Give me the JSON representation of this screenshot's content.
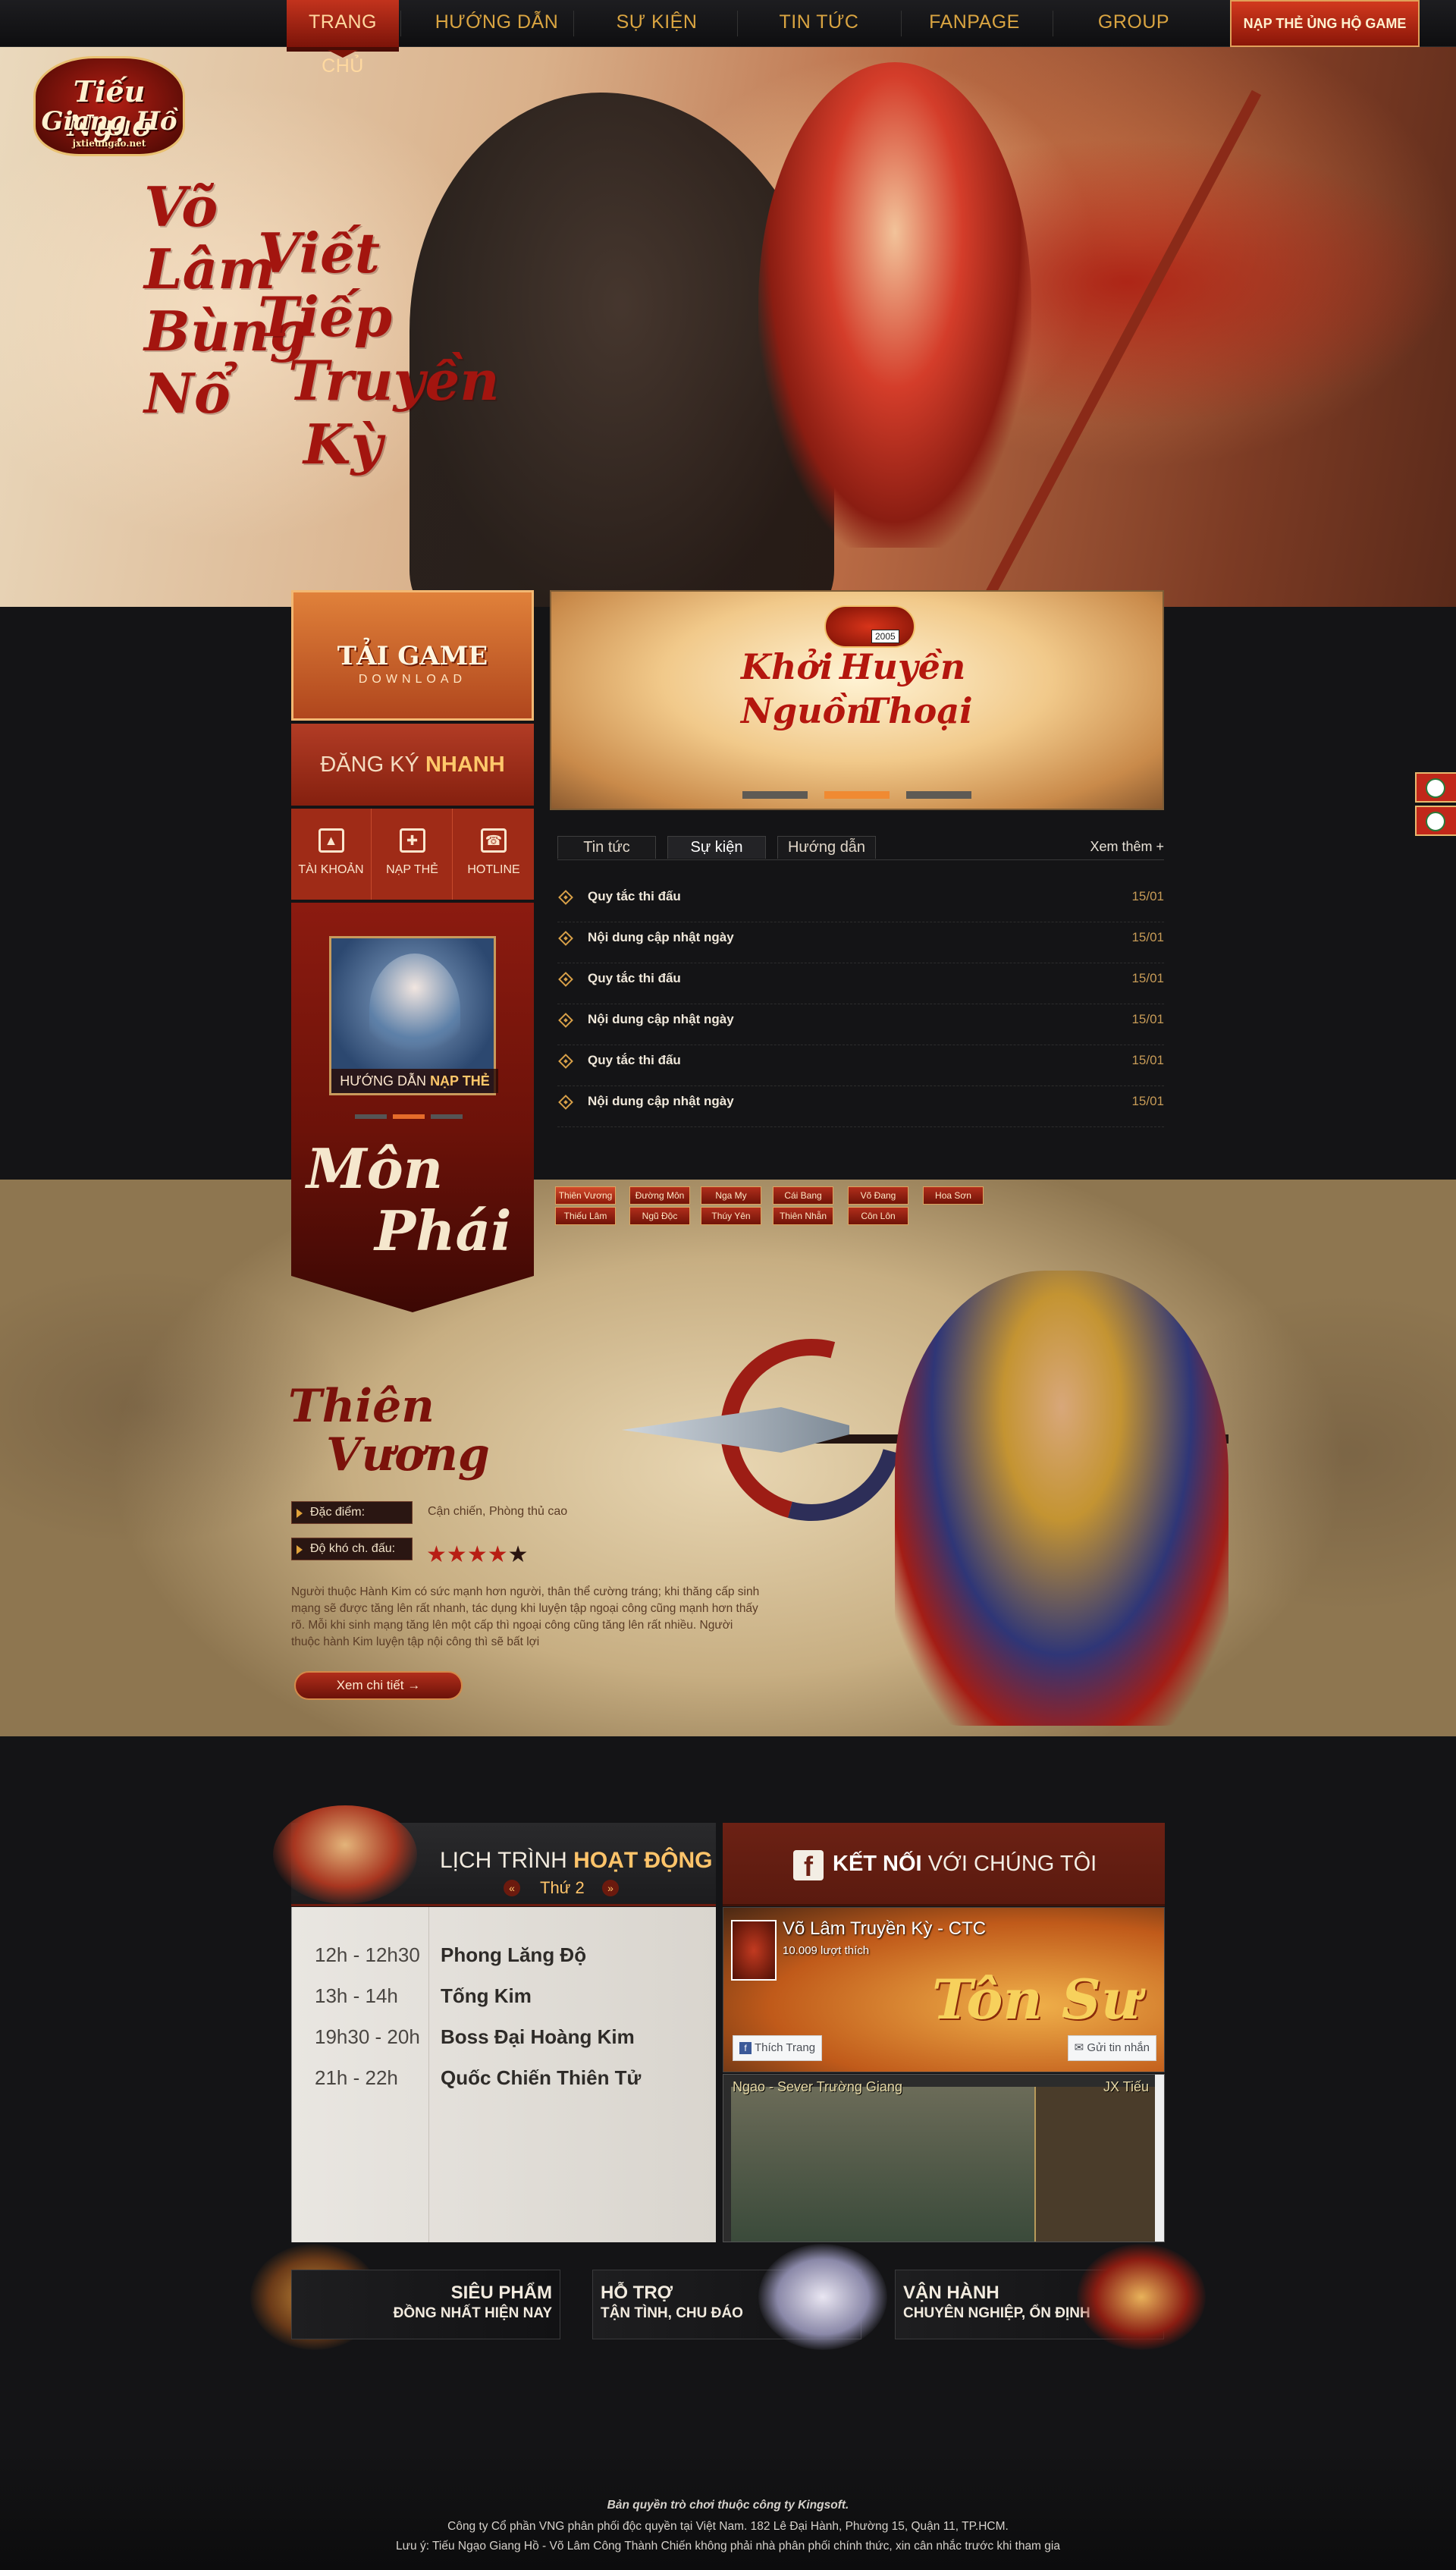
{
  "nav": {
    "items": [
      "TRANG CHỦ",
      "HƯỚNG DẪN",
      "SỰ KIỆN",
      "TIN TỨC",
      "FANPAGE",
      "GROUP"
    ],
    "topup_button": "NẠP THẺ ỦNG HỘ GAME"
  },
  "hero": {
    "logo_line1": "Tiếu Ngạo",
    "logo_line2": "Giang Hồ",
    "logo_site": "jxtieungao.net",
    "slogan_col1": [
      "Võ",
      "Lâm",
      "Bùng",
      "Nổ"
    ],
    "slogan_col2": [
      "Viết",
      "Tiếp",
      "Truyền",
      "Kỳ"
    ]
  },
  "left_panel": {
    "download_title": "TẢI GAME",
    "download_sub": "DOWNLOAD",
    "register_prefix": "ĐĂNG KÝ",
    "register_bold": "NHANH",
    "quick_links": [
      {
        "label": "TÀI KHOẢN",
        "icon": "account-icon"
      },
      {
        "label": "NẠP THẺ",
        "icon": "gift-icon"
      },
      {
        "label": "HOTLINE",
        "icon": "phone-icon"
      }
    ],
    "promo_prefix": "HƯỚNG DẪN",
    "promo_bold": "NẠP THẺ",
    "promo_active_dot": 1
  },
  "banner": {
    "badge_year": "2005",
    "words": [
      "Khởi",
      "Huyền",
      "Nguồn",
      "Thoại"
    ],
    "active_dot": 1
  },
  "news": {
    "tabs": [
      "Tin tức",
      "Sự kiện",
      "Hướng dẫn"
    ],
    "active_tab": 1,
    "more": "Xem thêm +",
    "items": [
      {
        "title": "Quy tắc thi đấu",
        "date": "15/01"
      },
      {
        "title": "Nội dung cập nhật ngày",
        "date": "15/01"
      },
      {
        "title": "Quy tắc thi đấu",
        "date": "15/01"
      },
      {
        "title": "Nội dung cập nhật ngày",
        "date": "15/01"
      },
      {
        "title": "Quy tắc thi đấu",
        "date": "15/01"
      },
      {
        "title": "Nội dung cập nhật ngày",
        "date": "15/01"
      }
    ]
  },
  "faction": {
    "section_title": [
      "Môn",
      "Phái"
    ],
    "buttons_row1": [
      "Thiên Vương",
      "Đường Môn",
      "Nga My",
      "Cái Bang",
      "Võ Đang",
      "Hoa Sơn"
    ],
    "buttons_row2": [
      "Thiếu Lâm",
      "Ngũ Độc",
      "Thúy Yên",
      "Thiên Nhẫn",
      "Côn Lôn"
    ],
    "selected": "Thiên Vương",
    "class_name": [
      "Thiên",
      "Vương"
    ],
    "attr1_label": "Đặc điểm:",
    "attr1_value": "Cận chiến, Phòng thủ cao",
    "attr2_label": "Độ khó ch. đấu:",
    "difficulty_stars": 4,
    "difficulty_max": 5,
    "description": "Người thuộc Hành Kim có sức mạnh hơn người, thân thể cường tráng; khi thăng cấp sinh mạng sẽ được tăng lên rất nhanh, tác dụng khi luyện tập ngoại công cũng mạnh hơn thấy rõ. Mỗi khi sinh mạng tăng lên một cấp thì ngoại công cũng tăng lên rất nhiều. Người thuộc hành Kim luyện tập nội công thì sẽ bất lợi",
    "detail_button": "Xem chi tiết"
  },
  "schedule": {
    "title_prefix": "LỊCH TRÌNH",
    "title_bold": "HOẠT ĐỘNG",
    "day": "Thứ 2",
    "rows": [
      {
        "time": "12h - 12h30",
        "event": "Phong Lăng Độ"
      },
      {
        "time": "13h - 14h",
        "event": "Tống Kim"
      },
      {
        "time": "19h30 - 20h",
        "event": "Boss Đại Hoàng Kim"
      },
      {
        "time": "21h - 22h",
        "event": "Quốc Chiến Thiên Tử"
      }
    ]
  },
  "connect": {
    "title_bold": "KẾT NỐI",
    "title_rest": "VỚI CHÚNG TÔI",
    "page_name": "Võ Lâm Truyền Kỳ - CTC",
    "likes": "10.009 lượt thích",
    "cover_text": "Tôn Sư",
    "like_button": "Thích Trang",
    "message_button": "Gửi tin nhắn",
    "video_title": "Ngao - Sever Trường Giang",
    "video_title_right": "JX Tiếu"
  },
  "features": [
    {
      "title": "SIÊU PHẨM",
      "sub": "ĐỒNG NHẤT HIỆN NAY"
    },
    {
      "title": "HỖ TRỢ",
      "sub": "TẬN TÌNH, CHU ĐÁO"
    },
    {
      "title": "VẬN HÀNH",
      "sub": "CHUYÊN NGHIỆP, ỔN ĐỊNH"
    }
  ],
  "footer": {
    "line1": "Bản quyền trò chơi thuộc công ty Kingsoft.",
    "line2": "Công ty Cổ phần VNG phân phối độc quyền tại Việt Nam. 182 Lê Đại Hành, Phường 15, Quận 11, TP.HCM.",
    "line3": "Lưu ý: Tiếu Ngạo Giang Hồ - Võ Lâm Công Thành Chiến không phải nhà phân phối chính thức, xin cân nhắc trước khi tham gia"
  },
  "colors": {
    "accent_red": "#b12e1b",
    "accent_gold": "#ffc46a",
    "nav_text": "#d9a441",
    "page_bg": "#141416"
  }
}
